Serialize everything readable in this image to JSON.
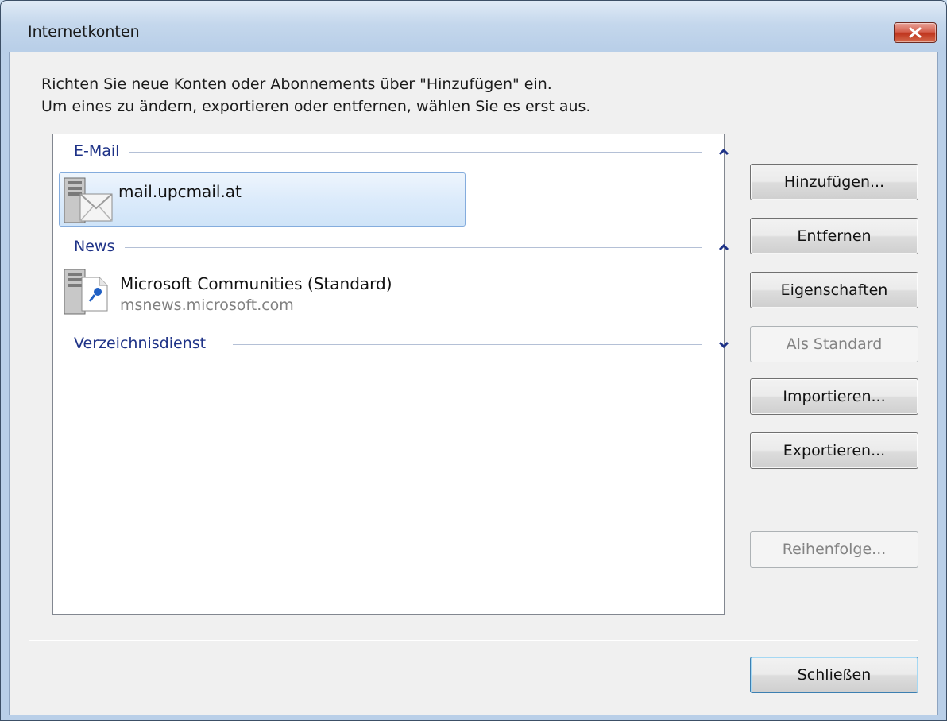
{
  "window": {
    "title": "Internetkonten"
  },
  "intro": {
    "line1": "Richten Sie neue Konten oder Abonnements über \"Hinzufügen\" ein.",
    "line2": "Um eines zu ändern, exportieren oder entfernen, wählen Sie es erst aus."
  },
  "groups": {
    "email": {
      "label": "E-Mail",
      "state": "expanded"
    },
    "news": {
      "label": "News",
      "state": "expanded"
    },
    "directory": {
      "label": "Verzeichnisdienst",
      "state": "collapsed"
    }
  },
  "accounts": {
    "email_item": {
      "name": "mail.upcmail.at",
      "icon": "mail-server-icon"
    },
    "news_item": {
      "name": "Microsoft Communities (Standard)",
      "server": "msnews.microsoft.com",
      "icon": "news-server-icon"
    }
  },
  "buttons": {
    "add": "Hinzufügen...",
    "remove": "Entfernen",
    "properties": "Eigenschaften",
    "set_default": "Als Standard",
    "import": "Importieren...",
    "export": "Exportieren...",
    "order": "Reihenfolge...",
    "close": "Schließen"
  },
  "colors": {
    "group_label": "#1e3287",
    "selection": "#cfe4f8",
    "close_button": "#c0361f"
  }
}
